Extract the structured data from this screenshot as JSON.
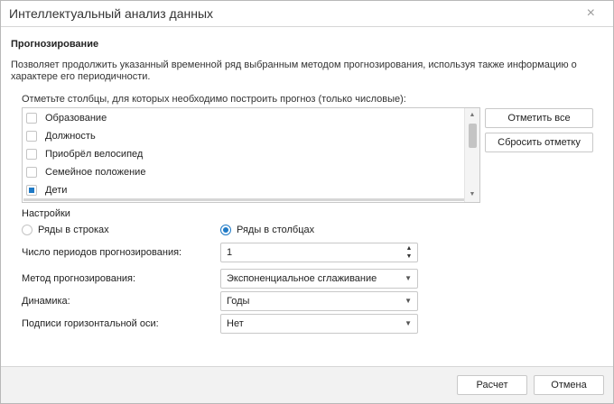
{
  "window": {
    "title": "Интеллектуальный анализ данных",
    "close_glyph": "×"
  },
  "main": {
    "section_title": "Прогнозирование",
    "description": "Позволяет продолжить указанный временной ряд выбранным методом прогнозирования, используя также информацию о характере его периодичности.",
    "columns_label": "Отметьте столбцы, для которых необходимо построить прогноз (только числовые):",
    "columns": [
      {
        "label": "Образование",
        "checked": false
      },
      {
        "label": "Должность",
        "checked": false
      },
      {
        "label": "Приобрёл велосипед",
        "checked": false
      },
      {
        "label": "Семейное положение",
        "checked": false
      },
      {
        "label": "Дети",
        "checked": true
      }
    ],
    "check_all_label": "Отметить все",
    "reset_label": "Сбросить отметку"
  },
  "settings": {
    "label": "Настройки",
    "radio_rows_label": "Ряды в строках",
    "radio_cols_label": "Ряды в столбцах",
    "selected_orientation": "columns",
    "periods_label": "Число периодов прогнозирования:",
    "periods_value": "1",
    "method_label": "Метод прогнозирования:",
    "method_value": "Экспоненциальное сглаживание",
    "dynamics_label": "Динамика:",
    "dynamics_value": "Годы",
    "axis_labels_label": "Подписи горизонтальной оси:",
    "axis_labels_value": "Нет"
  },
  "footer": {
    "calculate_label": "Расчет",
    "cancel_label": "Отмена"
  },
  "colors": {
    "accent": "#1f7ac6",
    "border": "#c8c8c8",
    "footer_bg": "#f2f2f2"
  }
}
